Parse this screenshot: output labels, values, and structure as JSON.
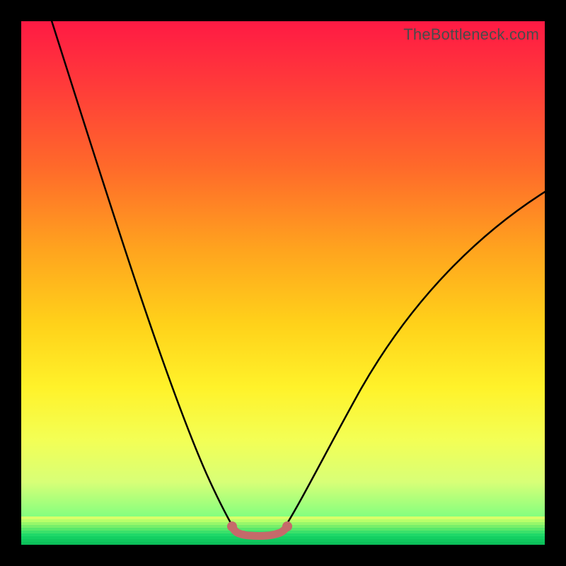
{
  "watermark": "TheBottleneck.com",
  "colors": {
    "black": "#000000",
    "curve": "#000000",
    "segment": "#c56a6a",
    "segment_dot": "#c56a6a"
  },
  "chart_data": {
    "type": "line",
    "title": "",
    "xlabel": "",
    "ylabel": "",
    "xlim": [
      0,
      100
    ],
    "ylim": [
      0,
      100
    ],
    "series": [
      {
        "name": "left-curve",
        "x": [
          2,
          5,
          8,
          12,
          16,
          20,
          24,
          28,
          32,
          35,
          37,
          39,
          40
        ],
        "y": [
          100,
          88,
          76,
          63,
          51,
          40,
          30,
          20,
          11,
          5,
          2,
          0.8,
          0.5
        ]
      },
      {
        "name": "right-curve",
        "x": [
          50,
          53,
          57,
          62,
          68,
          75,
          83,
          92,
          100
        ],
        "y": [
          0.5,
          2,
          6,
          13,
          22,
          33,
          45,
          57,
          68
        ]
      },
      {
        "name": "floor-segment",
        "x": [
          40,
          42,
          44,
          46,
          48,
          50
        ],
        "y": [
          0.5,
          0.3,
          0.3,
          0.3,
          0.3,
          0.5
        ]
      }
    ],
    "annotations": []
  }
}
